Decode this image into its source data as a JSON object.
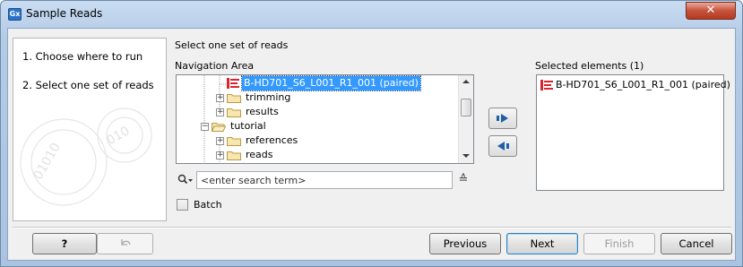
{
  "window": {
    "title": "Sample Reads",
    "app_icon_text": "Gx",
    "close_glyph": "✕"
  },
  "steps": [
    {
      "label": "1.  Choose where to run"
    },
    {
      "label": "2.  Select one set of reads"
    }
  ],
  "content": {
    "title": "Select one set of reads",
    "navigation_label": "Navigation Area",
    "selected_label": "Selected elements (1)"
  },
  "tree": {
    "rows": [
      {
        "label": "B-HD701_S6_L001_R1_001 (paired)",
        "type": "reads",
        "expander": "",
        "selected": true
      },
      {
        "label": "trimming",
        "type": "folder",
        "expander": "+",
        "selected": false
      },
      {
        "label": "results",
        "type": "folder",
        "expander": "+",
        "selected": false
      },
      {
        "label": "tutorial",
        "type": "folder-open",
        "expander": "−",
        "selected": false
      },
      {
        "label": "references",
        "type": "folder",
        "expander": "+",
        "selected": false
      },
      {
        "label": "reads",
        "type": "folder",
        "expander": "+",
        "selected": false
      }
    ]
  },
  "selected_elements": [
    {
      "label": "B-HD701_S6_L001_R1_001 (paired)",
      "icon": "reads-icon"
    }
  ],
  "search": {
    "placeholder": "<enter search term>",
    "value": ""
  },
  "batch": {
    "label": "Batch",
    "checked": false
  },
  "buttons": {
    "help": "?",
    "reset_icon": "reset-icon",
    "previous": "Previous",
    "next": "Next",
    "finish": "Finish",
    "cancel": "Cancel"
  },
  "colors": {
    "selection": "#3399ff",
    "reads_icon": "#d9232d",
    "arrow_blue": "#1f5fa8",
    "folder": "#f3d58a"
  }
}
